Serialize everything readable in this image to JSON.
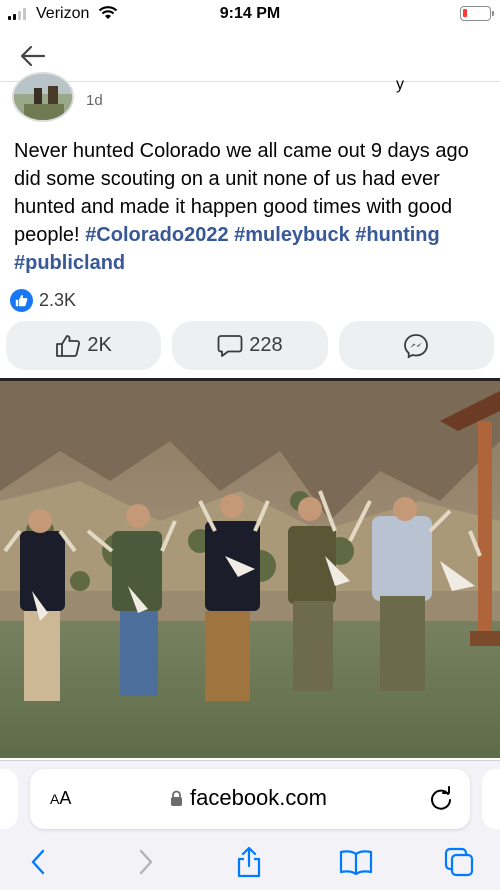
{
  "status_bar": {
    "carrier": "Verizon",
    "time": "9:14 PM"
  },
  "nav": {
    "back_icon": "arrow-left-icon"
  },
  "post": {
    "author_name_visible_tail": "y",
    "timestamp": "1d",
    "text": "Never hunted Colorado we all came out 9 days ago did some scouting on a unit none of us had ever hunted and made it happen good times with good people!",
    "hashtags": "#Colorado2022 #muleybuck #hunting #publicland",
    "reaction_count": "2.3K",
    "like_label": "2K",
    "comment_label": "228",
    "share_icon": "messenger-icon"
  },
  "photo": {
    "description_icon": "hunting-group-photo"
  },
  "browser": {
    "aa_label_big": "A",
    "aa_label_small": "A",
    "url": "facebook.com",
    "icons": [
      "back-chevron-icon",
      "forward-chevron-icon",
      "share-icon",
      "bookmarks-icon",
      "tabs-icon"
    ]
  },
  "colors": {
    "facebook_blue": "#1877f2",
    "hashtag": "#385898",
    "ios_blue": "#007aff",
    "battery_low": "#ff3b30"
  }
}
